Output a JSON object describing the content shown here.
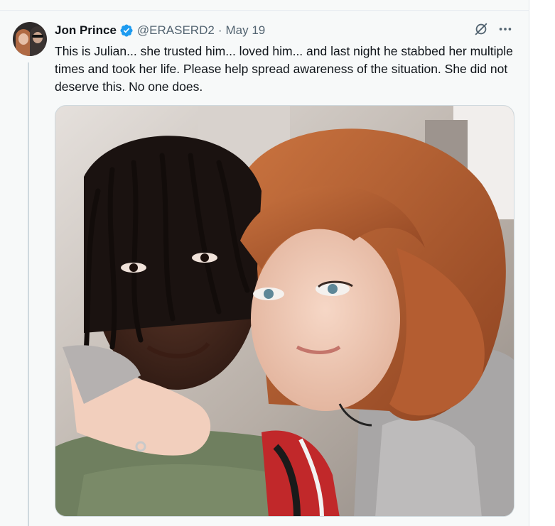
{
  "tweet": {
    "author_name": "Jon Prince",
    "handle": "@ERASERD2",
    "separator": "·",
    "date": "May 19",
    "text": "This is Julian... she trusted him... loved him... and last night he stabbed her multiple times and took her life. Please help spread awareness of the situation. She did not deserve this. No one does."
  },
  "icons": {
    "verified": "verified-badge-icon",
    "grok": "grok-icon",
    "more": "more-options-icon"
  },
  "colors": {
    "verified_blue": "#1d9bf0",
    "text_primary": "#0f1419",
    "text_secondary": "#536471"
  }
}
